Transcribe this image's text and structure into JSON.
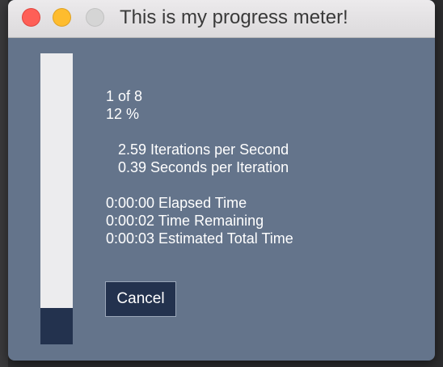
{
  "window": {
    "title": "This is my progress meter!"
  },
  "progress": {
    "fraction": 0.125,
    "fill_color": "#23324e",
    "track_color": "#ececee",
    "count": "1 of 8",
    "percent": "12 %",
    "iterations_per_second": "   2.59 Iterations per Second",
    "seconds_per_iteration": "   0.39 Seconds per Iteration",
    "elapsed": "0:00:00 Elapsed Time",
    "remaining": "0:00:02 Time Remaining",
    "estimated_total": "0:00:03 Estimated Total Time"
  },
  "buttons": {
    "cancel_label": "Cancel"
  },
  "colors": {
    "window_bg": "#64748b",
    "button_bg": "#23324e"
  }
}
